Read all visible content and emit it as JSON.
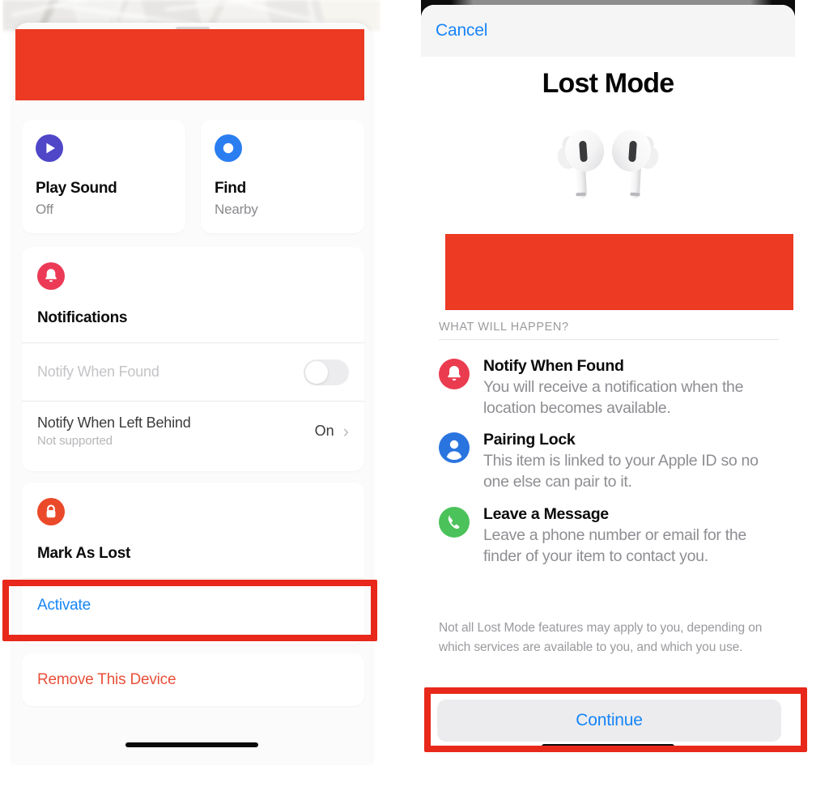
{
  "left_panel": {
    "redaction_color": "#ec3a23",
    "action_cards": [
      {
        "icon": "play-sound-icon",
        "title": "Play Sound",
        "subtitle": "Off",
        "color": "#4f46c8"
      },
      {
        "icon": "find-nearby-icon",
        "title": "Find",
        "subtitle": "Nearby",
        "color": "#2a7ef0"
      }
    ],
    "notifications": {
      "icon": "bell-icon",
      "icon_color": "#ec3a56",
      "title": "Notifications",
      "rows": [
        {
          "label": "Notify When Found",
          "sublabel": "",
          "control": "toggle",
          "toggle_state": "off",
          "dimmed": true,
          "value": ""
        },
        {
          "label": "Notify When Left Behind",
          "sublabel": "Not supported",
          "control": "chevron",
          "value": "On",
          "chevron": "›",
          "dimmed": false
        }
      ]
    },
    "mark_as_lost": {
      "icon": "lock-icon",
      "icon_color": "#ea4a2a",
      "title": "Mark As Lost",
      "activate_label": "Activate"
    },
    "remove_device_label": "Remove This Device",
    "highlight_color": "#e8281a"
  },
  "right_panel": {
    "nav": {
      "cancel_label": "Cancel"
    },
    "title": "Lost Mode",
    "hero_image": "airpods-pro-image",
    "redaction_color": "#ec3a23",
    "section_caption": "WHAT WILL HAPPEN?",
    "features": [
      {
        "icon": "bell-icon",
        "icon_color": "#eb3b4f",
        "title": "Notify When Found",
        "description": "You will receive a notification when the location becomes available."
      },
      {
        "icon": "person-icon",
        "icon_color": "#2a74e0",
        "title": "Pairing Lock",
        "description": "This item is linked to your Apple ID so no one else can pair to it."
      },
      {
        "icon": "phone-icon",
        "icon_color": "#4cc25a",
        "title": "Leave a Message",
        "description": "Leave a phone number or email for the finder of your item to contact you."
      }
    ],
    "disclaimer": "Not all Lost Mode features may apply to you, depending on which services are available to you, and which you use.",
    "continue_label": "Continue",
    "highlight_color": "#e8281a"
  }
}
